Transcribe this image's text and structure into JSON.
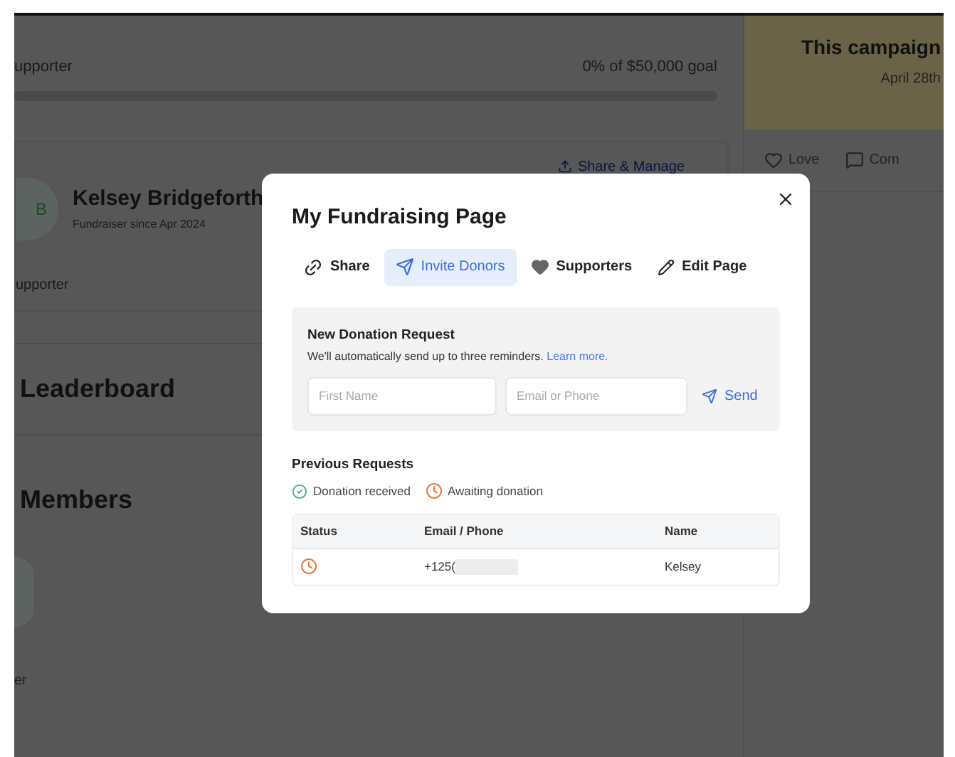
{
  "background": {
    "supporter_count": "upporter",
    "goal": "0% of $50,000 goal",
    "campaign_title": "This campaign",
    "campaign_date": "April 28th",
    "reactions": [
      {
        "kind": "love",
        "label": "Love"
      },
      {
        "kind": "comment",
        "label": "Com"
      }
    ],
    "share_manage": "Share & Manage",
    "avatar_initial": "B",
    "name": "Kelsey Bridgeforth",
    "since": "Fundraiser since Apr 2024",
    "supporter_label": "upporter",
    "leaderboard": "Leaderboard",
    "members": "Members",
    "member_caption": "er"
  },
  "modal": {
    "title": "My Fundraising Page",
    "tabs": [
      {
        "kind": "share",
        "label": "Share",
        "selected": false
      },
      {
        "kind": "invite",
        "label": "Invite Donors",
        "selected": true
      },
      {
        "kind": "supporters",
        "label": "Supporters",
        "selected": false
      },
      {
        "kind": "edit",
        "label": "Edit Page",
        "selected": false
      }
    ],
    "request": {
      "heading": "New Donation Request",
      "note": "We'll automatically send up to three reminders.",
      "link": "Learn more.",
      "first_name": {
        "placeholder": "First Name"
      },
      "contact": {
        "placeholder": "Email or Phone"
      },
      "send": "Send"
    },
    "previous": {
      "heading": "Previous Requests",
      "legend": [
        {
          "kind": "received",
          "label": "Donation received"
        },
        {
          "kind": "awaiting",
          "label": "Awaiting donation"
        }
      ],
      "columns": [
        "Status",
        "Email / Phone",
        "Name"
      ],
      "rows": [
        {
          "kind": "awaiting",
          "contact": "+125(",
          "name": "Kelsey"
        }
      ]
    }
  }
}
